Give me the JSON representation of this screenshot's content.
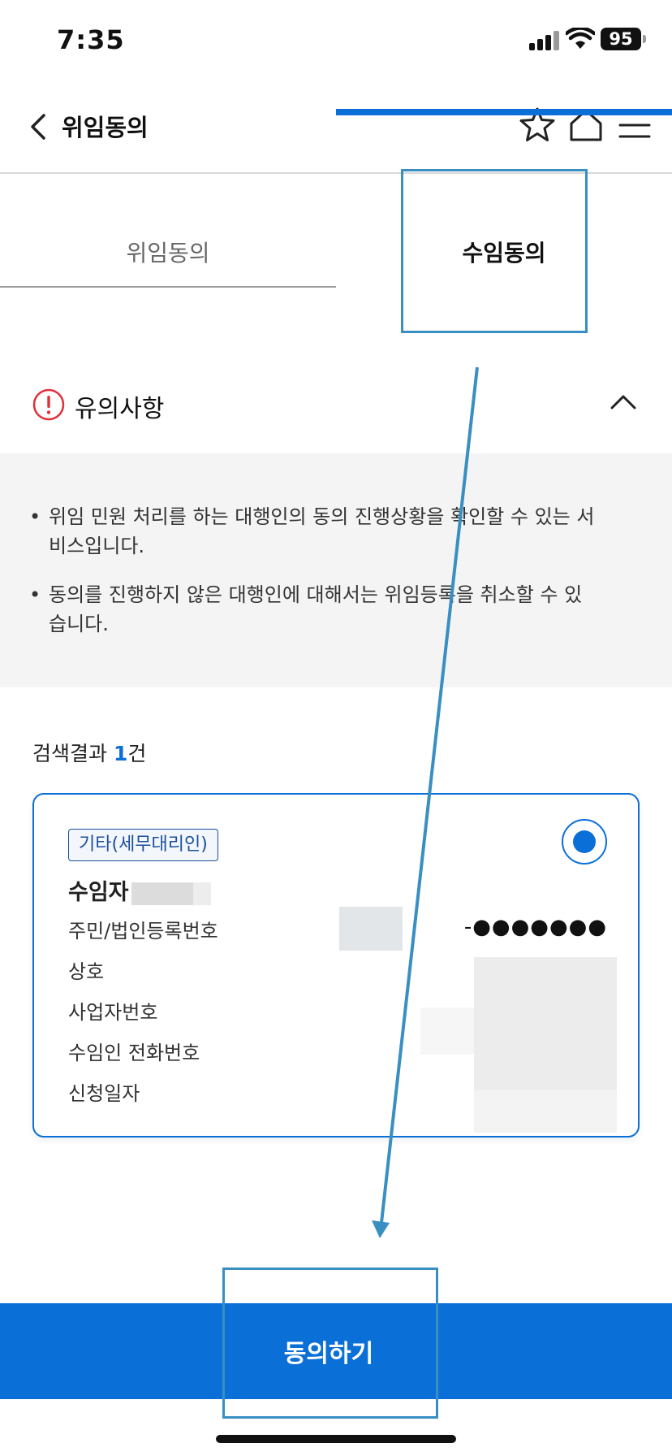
{
  "status_bar": {
    "time": "7:35",
    "battery": "95"
  },
  "header": {
    "title": "위임동의"
  },
  "tabs": [
    {
      "label": "위임동의",
      "active": false
    },
    {
      "label": "수임동의",
      "active": true
    }
  ],
  "notice": {
    "title": "유의사항",
    "items": [
      "위임 민원 처리를 하는 대행인의 동의 진행상황을 확인할 수 있는 서비스입니다.",
      "동의를 진행하지 않은 대행인에 대해서는 위임등록을 취소할 수 있습니다."
    ]
  },
  "results": {
    "prefix": "검색결과 ",
    "count": "1",
    "suffix": "건"
  },
  "card": {
    "badge": "기타(세무대리인)",
    "name_label": "수임자",
    "rows": [
      {
        "label": "주민/법인등록번호",
        "value": "-●●●●●●●"
      },
      {
        "label": "상호"
      },
      {
        "label": "사업자번호"
      },
      {
        "label": "수임인 전화번호"
      },
      {
        "label": "신청일자"
      }
    ]
  },
  "actions": {
    "agree_label": "동의하기"
  },
  "colors": {
    "primary": "#0a6fd6",
    "annotation": "#3a8fc2",
    "alert": "#e0303a"
  }
}
